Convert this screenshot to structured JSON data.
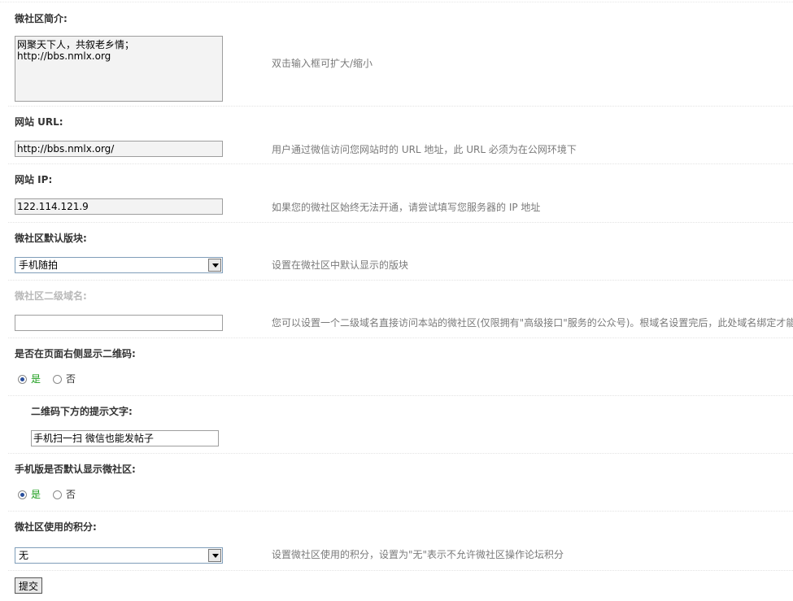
{
  "fields": {
    "intro": {
      "label": "微社区简介:",
      "value": "网聚天下人，共叙老乡情；\nhttp://bbs.nmlx.org",
      "tip": "双击输入框可扩大/缩小"
    },
    "site_url": {
      "label": "网站 URL:",
      "value": "http://bbs.nmlx.org/",
      "tip": "用户通过微信访问您网站时的 URL 地址，此 URL 必须为在公网环境下"
    },
    "site_ip": {
      "label": "网站 IP:",
      "value": "122.114.121.9",
      "tip": "如果您的微社区始终无法开通，请尝试填写您服务器的 IP 地址"
    },
    "default_board": {
      "label": "微社区默认版块:",
      "value": "手机随拍",
      "tip": "设置在微社区中默认显示的版块"
    },
    "subdomain": {
      "label": "微社区二级域名:",
      "value": "",
      "tip": "您可以设置一个二级域名直接访问本站的微社区(仅限拥有\"高级接口\"服务的公众号)。根域名设置完后，此处域名绑定才能"
    },
    "show_qrcode": {
      "label": "是否在页面右侧显示二维码:",
      "yes": "是",
      "no": "否",
      "selected": "yes"
    },
    "qrcode_text": {
      "label": "二维码下方的提示文字:",
      "value": "手机扫一扫 微信也能发帖子"
    },
    "mobile_default": {
      "label": "手机版是否默认显示微社区:",
      "yes": "是",
      "no": "否",
      "selected": "yes"
    },
    "credits": {
      "label": "微社区使用的积分:",
      "value": "无",
      "tip": "设置微社区使用的积分，设置为\"无\"表示不允许微社区操作论坛积分"
    }
  },
  "submit_label": "提交"
}
